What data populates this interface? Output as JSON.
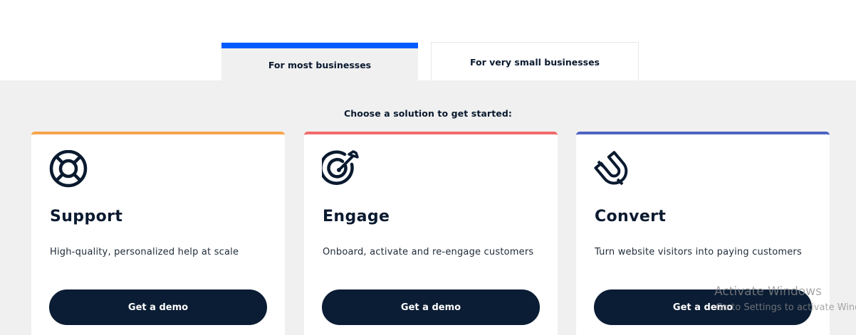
{
  "tabs": [
    {
      "label": "For most businesses",
      "active": true
    },
    {
      "label": "For very small businesses",
      "active": false
    }
  ],
  "prompt": "Choose a solution to get started:",
  "colors": {
    "active_tab_bar": "#005cff",
    "button_bg": "#0b1d34",
    "support_accent": "#f5a54a",
    "engage_accent": "#f26b6b",
    "convert_accent": "#4f63c2",
    "page_gray": "#f0f0f0"
  },
  "cards": [
    {
      "icon": "lifebuoy-icon",
      "title": "Support",
      "description": "High-quality, personalized help at scale",
      "button_label": "Get a demo"
    },
    {
      "icon": "target-arrow-icon",
      "title": "Engage",
      "description": "Onboard, activate and re-engage customers",
      "button_label": "Get a demo"
    },
    {
      "icon": "magnet-icon",
      "title": "Convert",
      "description": "Turn website visitors into paying customers",
      "button_label": "Get a demo"
    }
  ],
  "watermark": {
    "title": "Activate Windows",
    "subtitle": "Go to Settings to activate Windows."
  }
}
